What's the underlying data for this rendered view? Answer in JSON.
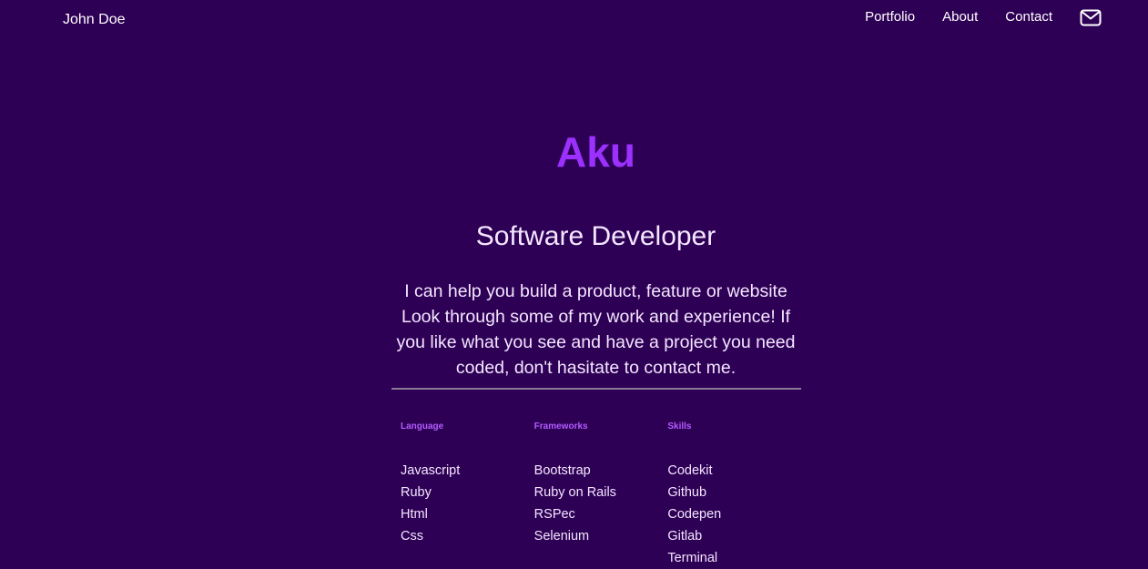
{
  "nav": {
    "brand": "John Doe",
    "links": [
      {
        "label": "Portfolio"
      },
      {
        "label": "About"
      },
      {
        "label": "Contact"
      }
    ],
    "mail_icon": "mail-icon"
  },
  "hero": {
    "name": "Aku",
    "title": "Software Developer",
    "description": "I can help you build a product, feature or website Look through some of my work and experience! If you like what you see and have a project you need coded, don't hasitate to contact me."
  },
  "skills": {
    "columns": [
      {
        "heading": "Language",
        "items": [
          "Javascript",
          "Ruby",
          "Html",
          "Css"
        ]
      },
      {
        "heading": "Frameworks",
        "items": [
          "Bootstrap",
          "Ruby on Rails",
          "RSPec",
          "Selenium"
        ]
      },
      {
        "heading": "Skills",
        "items": [
          "Codekit",
          "Github",
          "Codepen",
          "Gitlab",
          "Terminal"
        ]
      }
    ]
  },
  "colors": {
    "background": "#2e0055",
    "accent": "#9b30ff",
    "heading_accent": "#b35cff",
    "text": "#f3e6ff"
  }
}
